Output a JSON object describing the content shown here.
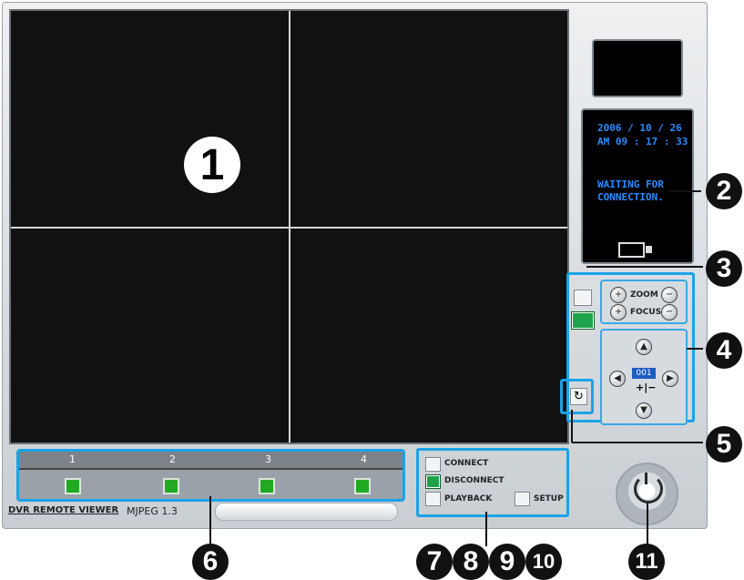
{
  "status": {
    "date": "2006 / 10 / 26",
    "time": "AM 09 : 17 : 33",
    "message": "WAITING FOR\nCONNECTION."
  },
  "ptz": {
    "zoom_label": "ZOOM",
    "focus_label": "FOCUS",
    "preset": "001",
    "plus_minus": "+|−"
  },
  "channels": [
    "1",
    "2",
    "3",
    "4"
  ],
  "actions": {
    "connect": "CONNECT",
    "disconnect": "DISCONNECT",
    "playback": "PLAYBACK",
    "setup": "SETUP"
  },
  "footer": {
    "app": "DVR REMOTE VIEWER",
    "version": "MJPEG 1.3"
  },
  "callouts": [
    "1",
    "2",
    "3",
    "4",
    "5",
    "6",
    "7",
    "8",
    "9",
    "10",
    "11"
  ]
}
